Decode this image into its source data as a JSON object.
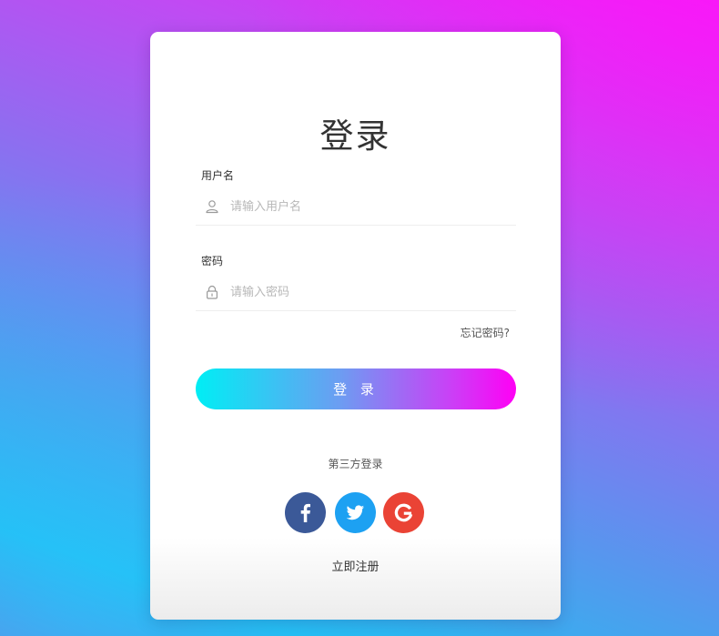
{
  "login": {
    "title": "登录",
    "username": {
      "label": "用户名",
      "placeholder": "请输入用户名",
      "value": "",
      "icon": "user-icon"
    },
    "password": {
      "label": "密码",
      "placeholder": "请输入密码",
      "value": "",
      "icon": "lock-icon"
    },
    "forgot_label": "忘记密码?",
    "submit_label": "登 录",
    "third_party": {
      "title": "第三方登录",
      "providers": [
        {
          "name": "facebook",
          "icon": "facebook-icon",
          "color": "#3b5998"
        },
        {
          "name": "twitter",
          "icon": "twitter-icon",
          "color": "#1da1f2"
        },
        {
          "name": "google",
          "icon": "google-icon",
          "color": "#ea4335"
        }
      ]
    },
    "register_label": "立即注册"
  },
  "colors": {
    "button_gradient_start": "#00eef4",
    "button_gradient_end": "#ff00f5",
    "background_top_right": "#f21cf7",
    "background_bottom_left": "#24bdf2"
  }
}
